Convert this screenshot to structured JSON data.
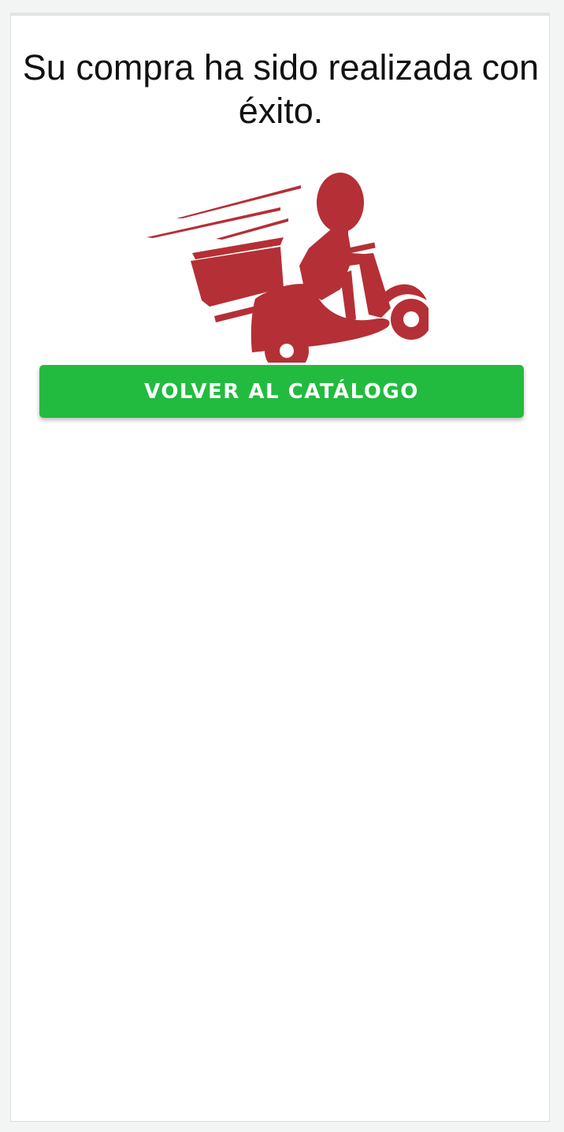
{
  "confirmation": {
    "message": "Su compra ha sido realizada con éxito.",
    "illustration_icon": "delivery-scooter-icon",
    "illustration_color": "#b52f36"
  },
  "actions": {
    "back_to_catalog_label": "VOLVER AL CATÁLOGO",
    "button_color": "#22bb40"
  }
}
